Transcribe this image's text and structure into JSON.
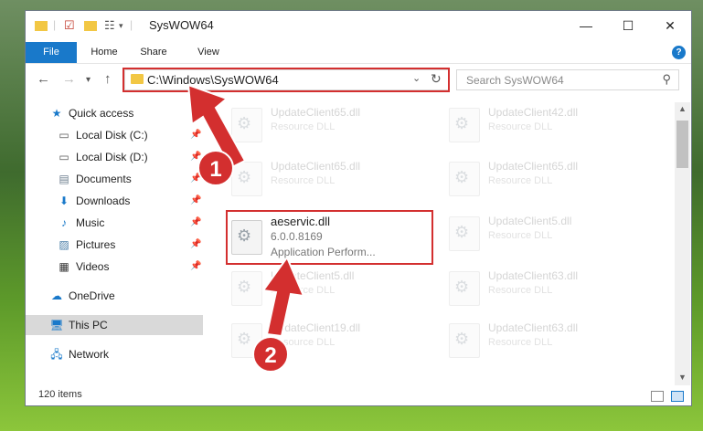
{
  "window": {
    "title": "SysWOW64",
    "minimize": "—",
    "maximize": "☐",
    "close": "✕"
  },
  "ribbon": {
    "tabs": [
      "File",
      "Home",
      "Share",
      "View"
    ],
    "help": "?"
  },
  "address": {
    "path": "C:\\Windows\\SysWOW64",
    "search_placeholder": "Search SysWOW64"
  },
  "nav": {
    "items": [
      {
        "label": "Quick access",
        "icon": "star-icon"
      },
      {
        "label": "Local Disk (C:)",
        "icon": "drive-icon",
        "pinned": true
      },
      {
        "label": "Local Disk (D:)",
        "icon": "drive-icon",
        "pinned": true
      },
      {
        "label": "Documents",
        "icon": "document-icon",
        "pinned": true
      },
      {
        "label": "Downloads",
        "icon": "download-icon",
        "pinned": true
      },
      {
        "label": "Music",
        "icon": "music-icon",
        "pinned": true
      },
      {
        "label": "Pictures",
        "icon": "pictures-icon",
        "pinned": true
      },
      {
        "label": "Videos",
        "icon": "videos-icon",
        "pinned": true
      },
      {
        "label": "OneDrive",
        "icon": "cloud-icon"
      },
      {
        "label": "This PC",
        "icon": "computer-icon",
        "selected": true
      },
      {
        "label": "Network",
        "icon": "network-icon"
      }
    ]
  },
  "files": [
    {
      "name": "UpdateClient65.dll",
      "desc": "Resource DLL"
    },
    {
      "name": "UpdateClient42.dll",
      "desc": "Resource DLL"
    },
    {
      "name": "UpdateClient65.dll",
      "desc": "Resource DLL"
    },
    {
      "name": "UpdateClient65.dll",
      "desc": "Resource DLL"
    },
    {
      "name": "aeservic.dll",
      "version": "6.0.0.8169",
      "desc": "Application Perform..."
    },
    {
      "name": "UpdateClient5.dll",
      "desc": "Resource DLL"
    },
    {
      "name": "UpdateClient5.dll",
      "desc": "Resource DLL"
    },
    {
      "name": "UpdateClient63.dll",
      "desc": "Resource DLL"
    },
    {
      "name": "UpdateClient19.dll",
      "desc": "Resource DLL"
    },
    {
      "name": "UpdateClient63.dll",
      "desc": "Resource DLL"
    }
  ],
  "status": {
    "item_count": "120 items"
  },
  "callouts": [
    "1",
    "2"
  ],
  "colors": {
    "accent": "#1979ca",
    "highlight": "#d32f2f"
  }
}
